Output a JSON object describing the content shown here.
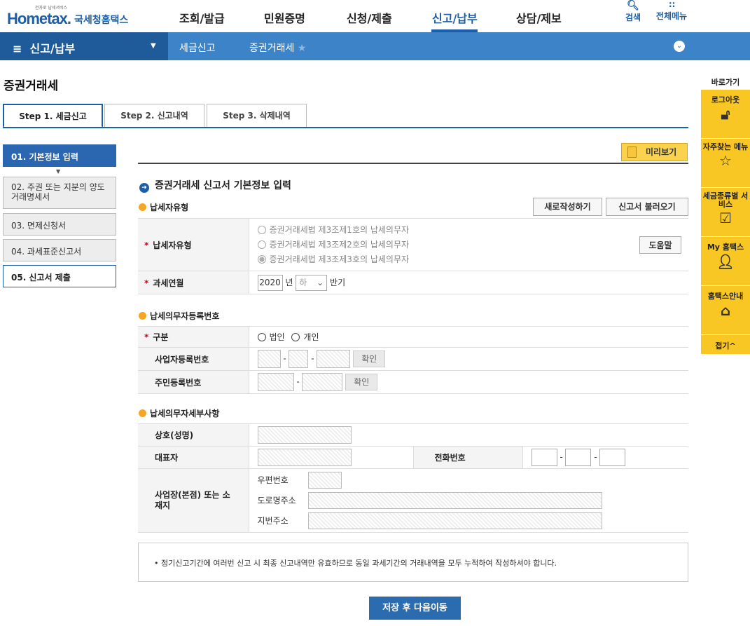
{
  "top": {
    "logo_small": "전자로 납세서비스",
    "logo_text": "Hometax.",
    "logo_kr": "국세청홈택스",
    "menus": [
      "조회/발급",
      "민원증명",
      "신청/제출",
      "신고/납부",
      "상담/제보"
    ],
    "active_menu": "신고/납부",
    "search_label": "검색",
    "all_menu_label": "전체메뉴"
  },
  "breadcrumb": {
    "section": "신고/납부",
    "items": [
      "세금신고",
      "증권거래세"
    ]
  },
  "page_title": "증권거래세",
  "tabs": [
    "Step 1. 세금신고",
    "Step 2. 신고내역",
    "Step 3. 삭제내역"
  ],
  "steps": [
    "01. 기본정보 입력",
    "02. 주권 또는 지분의 양도 거래명세서",
    "03. 면제신청서",
    "04. 과세표준신고서",
    "05. 신고서 제출"
  ],
  "preview_label": "미리보기",
  "section_title": "증권거래세 신고서 기본정보 입력",
  "taxpayer_type": {
    "heading": "납세자유형",
    "new_btn": "새로작성하기",
    "load_btn": "신고서 불러오기",
    "label": "납세자유형",
    "options": [
      "증권거래세법 제3조제1호의 납세의무자",
      "증권거래세법 제3조제2호의 납세의무자",
      "증권거래세법 제3조제3호의 납세의무자"
    ],
    "selected": 2,
    "help_btn": "도움말",
    "period_label": "과세연월",
    "year": "2020",
    "year_unit": "년",
    "half": "하",
    "half_unit": "반기"
  },
  "registration": {
    "heading": "납세의무자등록번호",
    "category_label": "구분",
    "category_options": [
      "법인",
      "개인"
    ],
    "bizno_label": "사업자등록번호",
    "confirm": "확인",
    "rrn_label": "주민등록번호"
  },
  "details": {
    "heading": "납세의무자세부사항",
    "name_label": "상호(성명)",
    "rep_label": "대표자",
    "phone_label": "전화번호",
    "address_label": "사업장(본점) 또는 소재지",
    "zip_label": "우편번호",
    "road_label": "도로명주소",
    "lot_label": "지번주소"
  },
  "notice": "• 정기신고기간에 여러번 신고 시 최종 신고내역만 유효하므로 동일 과세기간의 거래내역을 모두 누적하여 작성하셔야 합니다.",
  "save_btn": "저장 후 다음이동",
  "quick": {
    "title": "바로가기",
    "logout": "로그아웃",
    "faq": "자주찾는 메뉴",
    "service": "세금종류별 서비스",
    "my": "My 홈택스",
    "guide": "홈택스안내",
    "fold": "접기^"
  },
  "colors": {
    "primary": "#1c5fa8",
    "accent": "#f9c724",
    "required": "#d0021b"
  }
}
